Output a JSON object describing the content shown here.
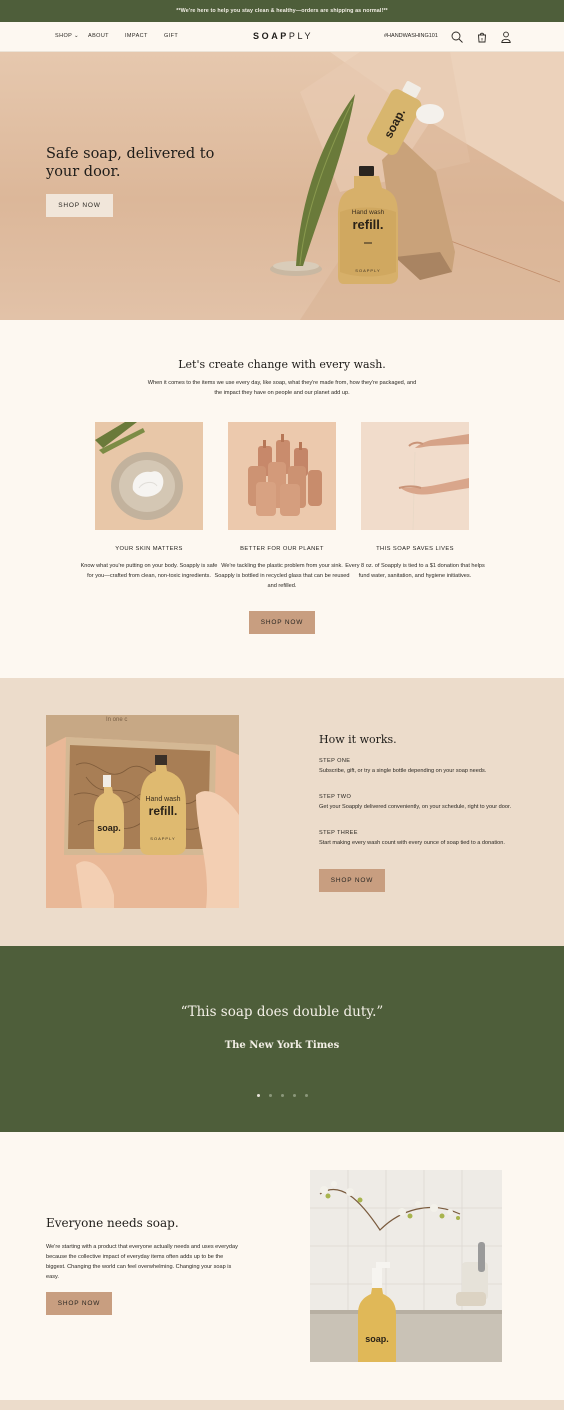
{
  "banner": {
    "text": "**We're here to help you stay clean & healthy—orders are shipping as normal!**"
  },
  "nav": {
    "links": [
      "SHOP",
      "ABOUT",
      "IMPACT",
      "GIFT"
    ],
    "logo_bold": "SOAP",
    "logo_light": "PLY",
    "hashtag": "#HANDWASHING101",
    "cart_count": "0"
  },
  "hero": {
    "headline": "Safe soap, delivered to your door.",
    "cta": "SHOP NOW",
    "bottle_label_small": "Hand wash",
    "bottle_label_big": "refill.",
    "bottle_brand": "SOAPPLY",
    "top_bottle_label": "soap."
  },
  "mission": {
    "title": "Let's create change with every wash.",
    "lead": "When it comes to the items we use every day, like soap, what they're made from, how they're packaged, and the impact they have on people and our planet add up.",
    "features": [
      {
        "title": "YOUR SKIN MATTERS",
        "body": "Know what you're putting on your body. Soapply is safe for you—crafted from clean, non-toxic ingredients."
      },
      {
        "title": "BETTER FOR OUR PLANET",
        "body": "We're tackling the plastic problem from your sink. Soapply is bottled in recycled glass that can be reused and refilled."
      },
      {
        "title": "THIS SOAP SAVES LIVES",
        "body": "Every 8 oz. of Soapply is tied to a $1 donation that helps fund water, sanitation, and hygiene initiatives."
      }
    ],
    "cta": "SHOP NOW"
  },
  "how": {
    "title": "How it works.",
    "steps": [
      {
        "heading": "STEP ONE",
        "text": "Subscribe, gift, or try a single bottle depending on your soap needs."
      },
      {
        "heading": "STEP TWO",
        "text": "Get your Soapply delivered conveniently, on your schedule, right to your door."
      },
      {
        "heading": "STEP THREE",
        "text": "Start making every wash count with every ounce of soap tied to a donation."
      }
    ],
    "cta": "SHOP NOW",
    "box_text": "In one c",
    "bottle_big_small": "Hand wash",
    "bottle_big_big": "refill.",
    "bottle_small": "soap.",
    "bottle_brand": "SOAPPLY"
  },
  "quote": {
    "text": "“This soap does double duty.”",
    "source": "The New York Times",
    "active_slide": 1,
    "slide_count": 5
  },
  "everyone": {
    "title": "Everyone needs soap.",
    "body": "We're starting with a product that everyone actually needs and uses everyday because the collective impact of everyday items often adds up to be the biggest. Changing the world can feel overwhelming. Changing your soap is easy.",
    "cta": "SHOP NOW",
    "bottle_label": "soap."
  },
  "colors": {
    "green": "#4e5e3a",
    "tan_button": "#c89e80",
    "cream": "#fdf8f1",
    "beige": "#ecdccb"
  }
}
